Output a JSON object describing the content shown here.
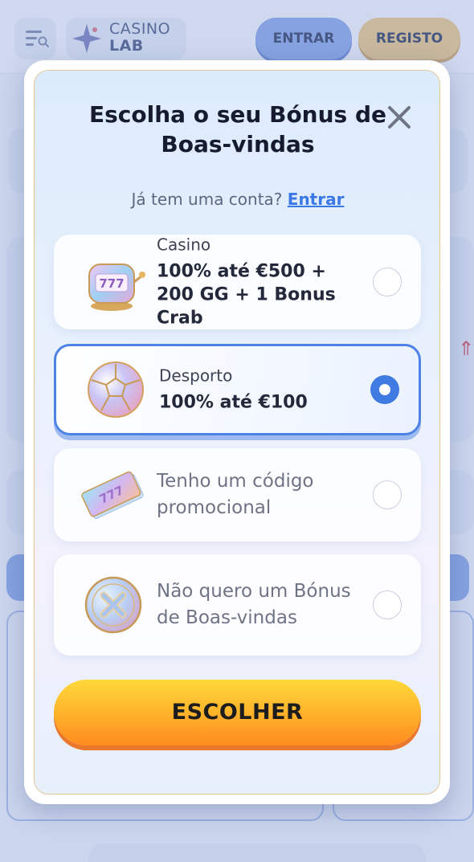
{
  "app": {
    "logo_line1": "CASINO",
    "logo_line2": "LAB",
    "login_label": "ENTRAR",
    "register_label": "REGISTO"
  },
  "modal": {
    "title": "Escolha o seu Bónus de Boas-vindas",
    "account_prompt": "Já tem uma conta?",
    "account_link": "Entrar",
    "options": [
      {
        "label": "Casino",
        "description": "100% até €500 + 200 GG + 1 Bonus Crab",
        "icon": "slot-machine-icon",
        "selected": false
      },
      {
        "label": "Desporto",
        "description": "100% até €100",
        "icon": "soccer-ball-icon",
        "selected": true
      },
      {
        "label": "Tenho um código promocional",
        "icon": "tickets-777-icon",
        "selected": false
      },
      {
        "label": "Não quero um Bónus de Boas-vindas",
        "icon": "x-coin-icon",
        "selected": false
      }
    ],
    "confirm_label": "ESCOLHER"
  },
  "colors": {
    "accent_blue": "#3f7be0",
    "cta_yellow": "#ffd83a",
    "cta_orange": "#ff8b1f"
  }
}
